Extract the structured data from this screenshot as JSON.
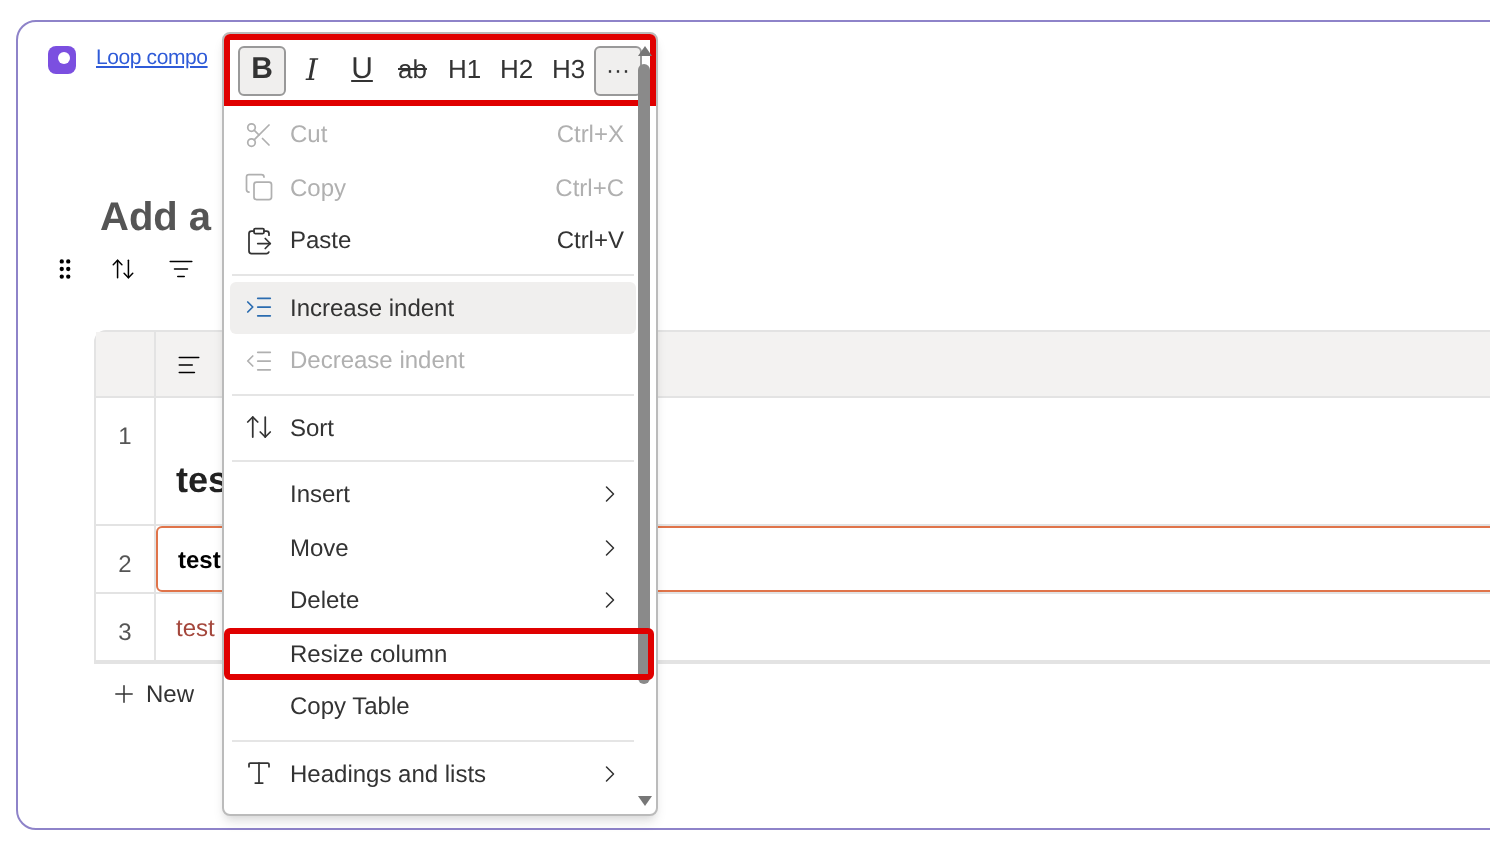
{
  "link": "Loop compo",
  "title": "Add a",
  "table": {
    "rows": [
      {
        "number": "1",
        "text": "tes",
        "kind": "heading",
        "selected": false
      },
      {
        "number": "2",
        "text": "test",
        "kind": "bold",
        "selected": true
      },
      {
        "number": "3",
        "text": "test",
        "kind": "link",
        "selected": false
      }
    ]
  },
  "new_button": "New",
  "toolbar": {
    "highlighted": true,
    "buttons": [
      {
        "label": "B",
        "kind": "bold",
        "selected": true
      },
      {
        "label": "I",
        "kind": "italic",
        "selected": false
      },
      {
        "label": "U",
        "kind": "underline",
        "selected": false
      },
      {
        "label": "ab",
        "kind": "strike",
        "selected": false
      },
      {
        "label": "H1",
        "kind": "plain",
        "selected": false
      },
      {
        "label": "H2",
        "kind": "plain",
        "selected": false
      },
      {
        "label": "H3",
        "kind": "plain",
        "selected": false
      },
      {
        "label": "···",
        "kind": "more",
        "selected": true
      }
    ]
  },
  "menu": [
    {
      "kind": "item",
      "label": "Cut",
      "shortcut": "Ctrl+X",
      "disabled": true,
      "hovered": false,
      "submenu": false,
      "highlighted": false
    },
    {
      "kind": "item",
      "label": "Copy",
      "shortcut": "Ctrl+C",
      "disabled": true,
      "hovered": false,
      "submenu": false,
      "highlighted": false
    },
    {
      "kind": "item",
      "label": "Paste",
      "shortcut": "Ctrl+V",
      "disabled": false,
      "hovered": false,
      "submenu": false,
      "highlighted": false
    },
    {
      "kind": "divider"
    },
    {
      "kind": "item",
      "label": "Increase indent",
      "disabled": false,
      "hovered": true,
      "submenu": false,
      "highlighted": false
    },
    {
      "kind": "item",
      "label": "Decrease indent",
      "disabled": true,
      "hovered": false,
      "submenu": false,
      "highlighted": false
    },
    {
      "kind": "divider"
    },
    {
      "kind": "item",
      "label": "Sort",
      "disabled": false,
      "hovered": false,
      "submenu": false,
      "highlighted": false
    },
    {
      "kind": "divider"
    },
    {
      "kind": "item",
      "label": "Insert",
      "disabled": false,
      "hovered": false,
      "submenu": true,
      "highlighted": false
    },
    {
      "kind": "item",
      "label": "Move",
      "disabled": false,
      "hovered": false,
      "submenu": true,
      "highlighted": false
    },
    {
      "kind": "item",
      "label": "Delete",
      "disabled": false,
      "hovered": false,
      "submenu": true,
      "highlighted": false
    },
    {
      "kind": "item",
      "label": "Resize column",
      "disabled": false,
      "hovered": false,
      "submenu": false,
      "highlighted": true
    },
    {
      "kind": "item",
      "label": "Copy Table",
      "disabled": false,
      "hovered": false,
      "submenu": false,
      "highlighted": false
    },
    {
      "kind": "divider"
    },
    {
      "kind": "item",
      "label": "Headings and lists",
      "disabled": false,
      "hovered": false,
      "submenu": true,
      "highlighted": false
    }
  ]
}
